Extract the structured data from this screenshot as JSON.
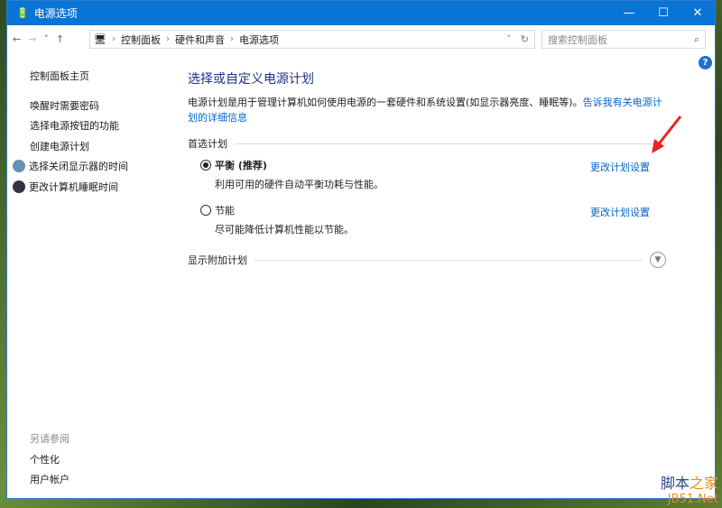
{
  "window": {
    "title": "电源选项",
    "minimize": "—",
    "maximize": "☐",
    "close": "✕"
  },
  "nav": {
    "back": "←",
    "forward": "→",
    "recent": "˅",
    "up": "↑"
  },
  "address": {
    "crumbs": [
      "控制面板",
      "硬件和声音",
      "电源选项"
    ],
    "dropdown": "˅",
    "refresh": "↻"
  },
  "search": {
    "placeholder": "搜索控制面板",
    "icon": "⌕"
  },
  "sidebar": {
    "items": [
      "控制面板主页",
      "唤醒时需要密码",
      "选择电源按钮的功能",
      "创建电源计划",
      "选择关闭显示器的时间",
      "更改计算机睡眠时间"
    ],
    "see_also": "另请参阅",
    "links": [
      "个性化",
      "用户帐户"
    ]
  },
  "main": {
    "heading": "选择或自定义电源计划",
    "description": "电源计划是用于管理计算机如何使用电源的一套硬件和系统设置(如显示器亮度、睡眠等)。",
    "link": "告诉我有关电源计划的详细信息",
    "group": "首选计划",
    "plans": [
      {
        "name": "平衡 (推荐)",
        "desc": "利用可用的硬件自动平衡功耗与性能。",
        "action": "更改计划设置",
        "selected": true
      },
      {
        "name": "节能",
        "desc": "尽可能降低计算机性能以节能。",
        "action": "更改计划设置",
        "selected": false
      }
    ],
    "more": "显示附加计划"
  },
  "help": "?",
  "watermark": {
    "a": "脚本",
    "b": "之家",
    "c": "JB51.Net"
  },
  "colors": {
    "titlebar": "#0a74d6",
    "link": "#0066cc",
    "heading": "#1e3287"
  }
}
